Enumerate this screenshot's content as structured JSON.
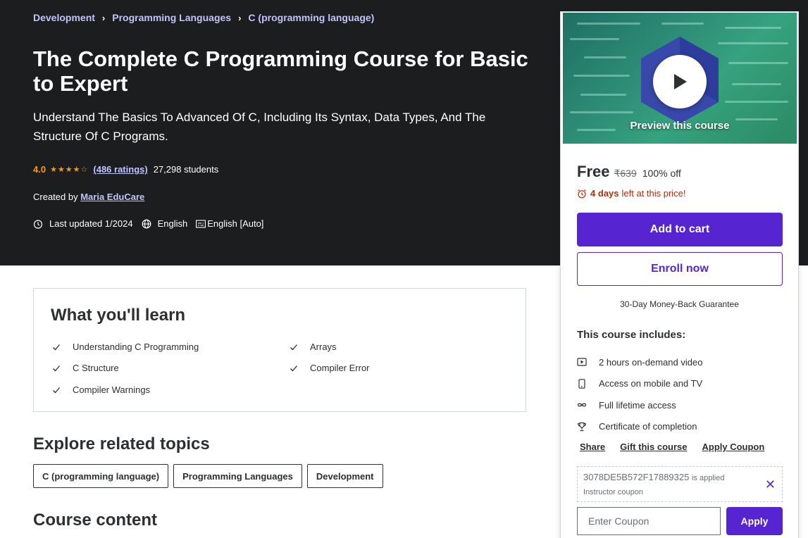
{
  "breadcrumb": [
    "Development",
    "Programming Languages",
    "C (programming language)"
  ],
  "course": {
    "title": "The Complete C Programming Course for Basic to Expert",
    "subtitle": "Understand The Basics To Advanced Of C, Including Its Syntax, Data Types, And The Structure Of C Programs.",
    "rating": "4.0",
    "rating_stars": 4,
    "ratings_count": "(486 ratings)",
    "students": "27,298 students",
    "created_by_label": "Created by",
    "instructor": "Maria EduCare",
    "last_updated": "Last updated 1/2024",
    "language": "English",
    "captions": "English [Auto]"
  },
  "sidebar": {
    "preview_label": "Preview this course",
    "price": "Free",
    "original_price": "₹639",
    "discount": "100% off",
    "timer_days": "4 days",
    "timer_suffix": "left at this price!",
    "add_to_cart": "Add to cart",
    "enroll_now": "Enroll now",
    "guarantee": "30-Day Money-Back Guarantee",
    "includes_title": "This course includes:",
    "includes": [
      {
        "icon": "video-icon",
        "text": "2 hours on-demand video"
      },
      {
        "icon": "mobile-icon",
        "text": "Access on mobile and TV"
      },
      {
        "icon": "infinity-icon",
        "text": "Full lifetime access"
      },
      {
        "icon": "trophy-icon",
        "text": "Certificate of completion"
      }
    ],
    "share": "Share",
    "gift": "Gift this course",
    "apply_coupon": "Apply Coupon",
    "coupon_code": "3078DE5B572F17889325",
    "coupon_applied": "is applied",
    "coupon_type": "Instructor coupon",
    "coupon_placeholder": "Enter Coupon",
    "apply": "Apply"
  },
  "learn": {
    "title": "What you'll learn",
    "items": [
      "Understanding C Programming",
      "Arrays",
      "C Structure",
      "Compiler Error",
      "Compiler Warnings"
    ]
  },
  "related": {
    "title": "Explore related topics",
    "topics": [
      "C (programming language)",
      "Programming Languages",
      "Development"
    ]
  },
  "course_content": {
    "title": "Course content"
  },
  "colors": {
    "accent": "#5624d0",
    "hero_bg": "#1c1d1f",
    "link": "#c0c4fc",
    "star": "#f69c08",
    "timer": "#b32d0f"
  }
}
